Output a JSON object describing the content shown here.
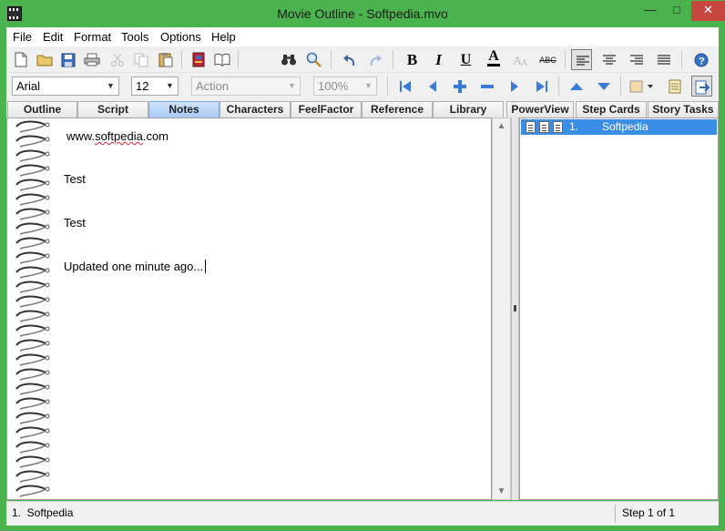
{
  "window": {
    "title": "Movie Outline - Softpedia.mvo",
    "minimize": "—",
    "maximize": "□",
    "close": "✕"
  },
  "menu": [
    "File",
    "Edit",
    "Format",
    "Tools",
    "Options",
    "Help"
  ],
  "toolbar": {
    "bold": "B",
    "italic": "I",
    "underline": "U",
    "font_color": "A",
    "spellcheck": "ABC"
  },
  "format_bar": {
    "font_name": "Arial",
    "font_size": "12",
    "element": "Action",
    "zoom": "100%"
  },
  "tabs": [
    "Outline",
    "Script",
    "Notes",
    "Characters",
    "FeelFactor",
    "Reference",
    "Library",
    "PowerView",
    "Step Cards",
    "Story Tasks"
  ],
  "active_tab": "Notes",
  "notes": {
    "line1_prefix": "www.",
    "line1_squiggle": "softpedia",
    "line1_suffix": ".com",
    "line2": "Test",
    "line3": "Test",
    "line4": "Updated one minute ago..."
  },
  "tree": {
    "number": "1.",
    "label": "Softpedia"
  },
  "status": {
    "left": "1.  Softpedia",
    "right": "Step 1 of 1"
  },
  "colors": {
    "frame": "#4bb34e",
    "selection": "#3a8ee6",
    "active_tab": "#a9c9f3"
  }
}
